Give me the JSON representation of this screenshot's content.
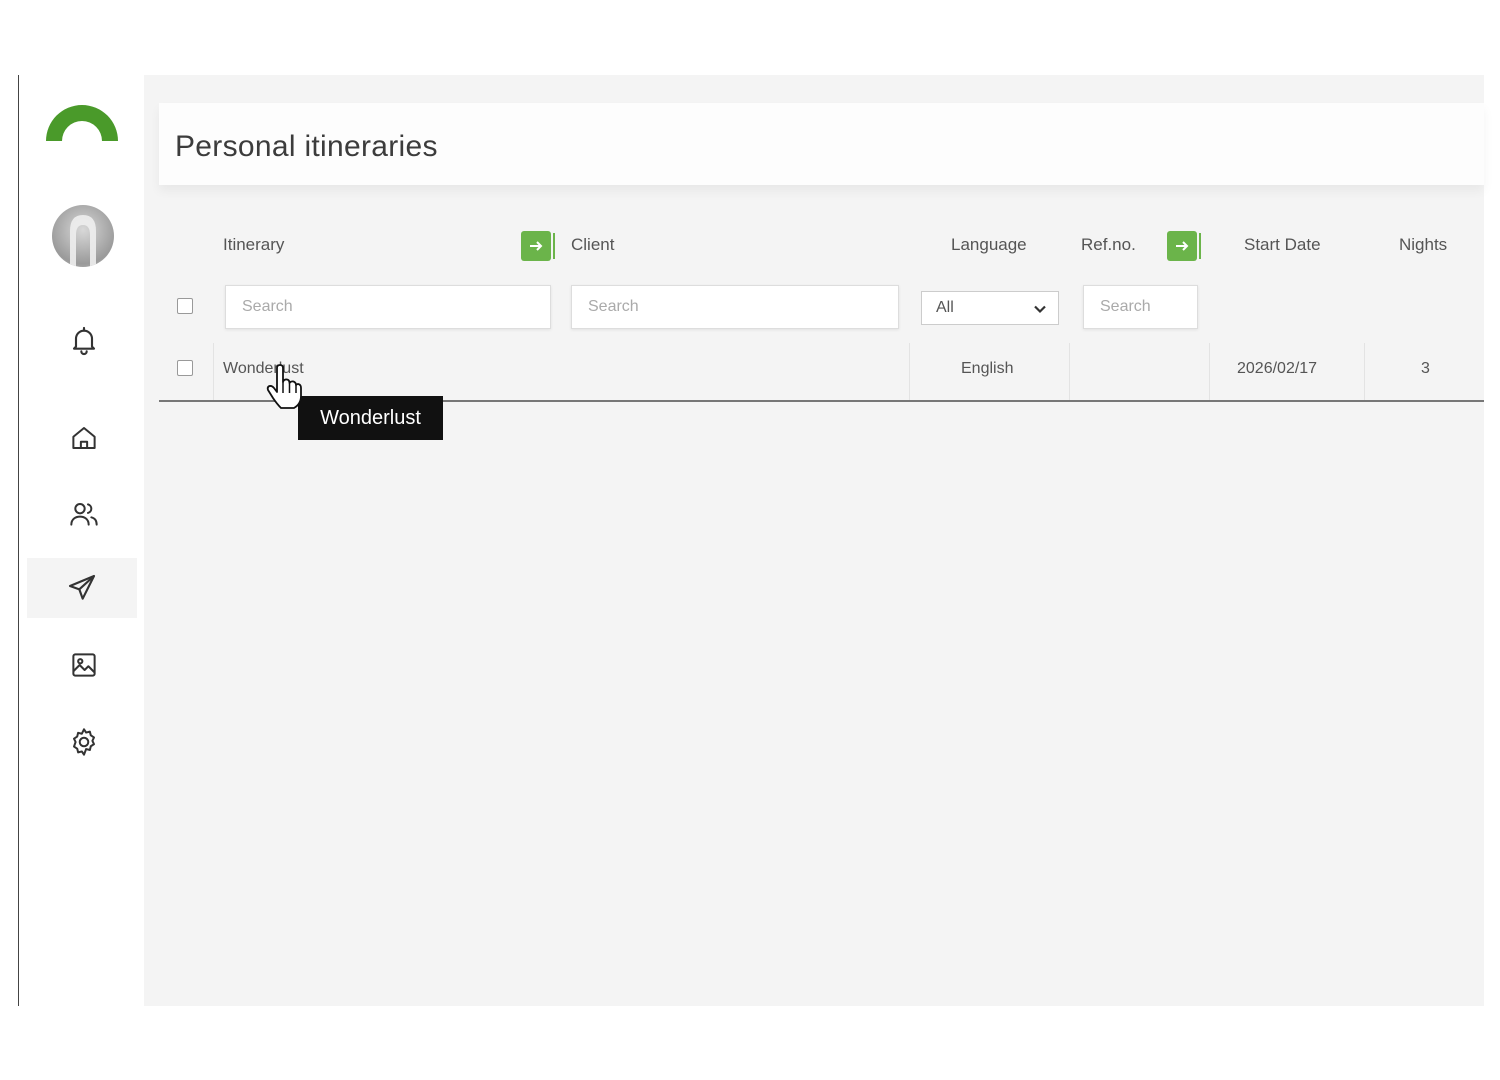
{
  "page": {
    "title": "Personal itineraries"
  },
  "sidebar": {
    "items": [
      {
        "name": "notifications",
        "icon": "bell-icon"
      },
      {
        "name": "home",
        "icon": "home-icon"
      },
      {
        "name": "clients",
        "icon": "users-icon"
      },
      {
        "name": "itineraries",
        "icon": "send-icon",
        "active": true
      },
      {
        "name": "images",
        "icon": "image-icon"
      },
      {
        "name": "settings",
        "icon": "gear-icon"
      }
    ]
  },
  "table": {
    "columns": {
      "itinerary": "Itinerary",
      "client": "Client",
      "language": "Language",
      "ref_no": "Ref.no.",
      "start_date": "Start Date",
      "nights": "Nights"
    },
    "filters": {
      "itinerary_placeholder": "Search",
      "client_placeholder": "Search",
      "language_selected": "All",
      "ref_placeholder": "Search"
    },
    "rows": [
      {
        "itinerary": "Wonderlust",
        "client": "",
        "language": "English",
        "ref_no": "",
        "start_date": "2026/02/17",
        "nights": "3"
      }
    ]
  },
  "tooltip": {
    "text": "Wonderlust"
  },
  "colors": {
    "accent": "#6bb44a",
    "logo": "#4a9a2a"
  }
}
